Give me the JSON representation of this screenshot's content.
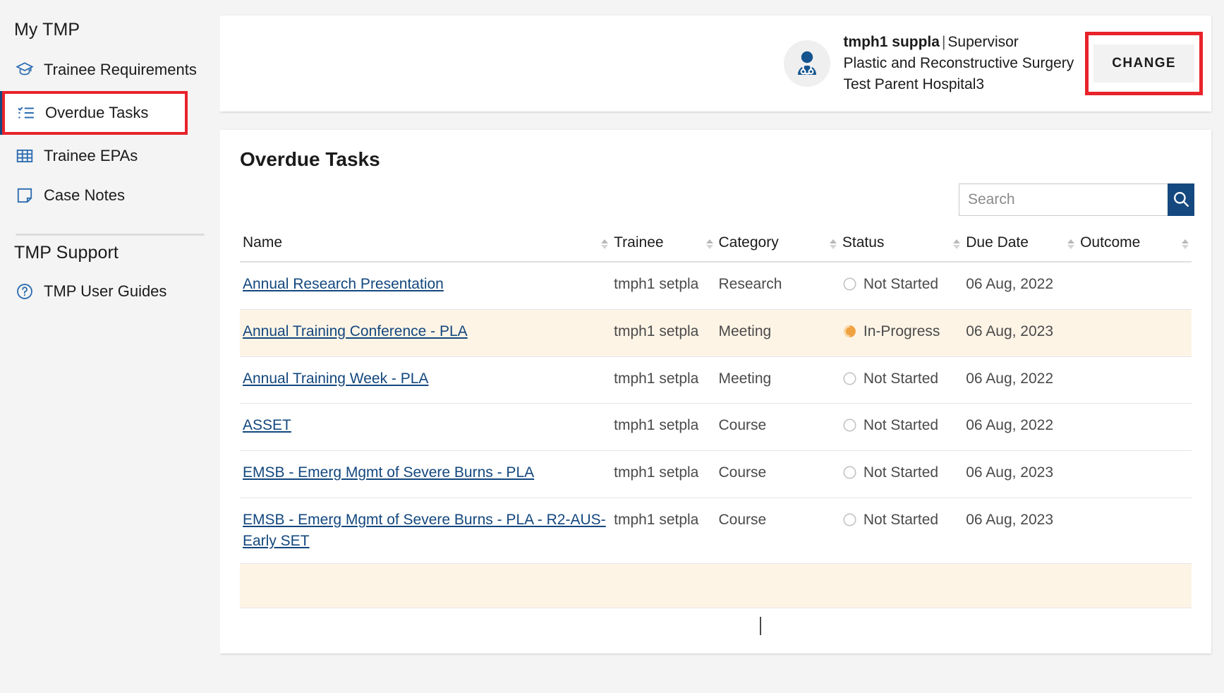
{
  "sidebar": {
    "sections": [
      {
        "heading": "My TMP",
        "items": [
          {
            "label": "Trainee Requirements",
            "icon": "graduation-cap-icon",
            "active": false
          },
          {
            "label": "Overdue Tasks",
            "icon": "checklist-icon",
            "active": true
          },
          {
            "label": "Trainee EPAs",
            "icon": "table-grid-icon",
            "active": false
          },
          {
            "label": "Case Notes",
            "icon": "note-page-icon",
            "active": false
          }
        ]
      },
      {
        "heading": "TMP Support",
        "items": [
          {
            "label": "TMP User Guides",
            "icon": "question-circle-icon",
            "active": false
          }
        ]
      }
    ]
  },
  "profile": {
    "avatar_icon": "doctor-avatar-icon",
    "name": "tmph1 suppla",
    "separator": "|",
    "role": "Supervisor",
    "specialty": "Plastic and Reconstructive Surgery",
    "hospital": "Test Parent Hospital3",
    "change_label": "CHANGE"
  },
  "tasks": {
    "title": "Overdue Tasks",
    "search": {
      "placeholder": "Search",
      "value": "",
      "button_icon": "search-icon"
    },
    "columns": [
      {
        "label": "Name",
        "sortable": true
      },
      {
        "label": "Trainee",
        "sortable": true
      },
      {
        "label": "Category",
        "sortable": true
      },
      {
        "label": "Status",
        "sortable": true
      },
      {
        "label": "Due Date",
        "sortable": true
      },
      {
        "label": "Outcome",
        "sortable": true
      }
    ],
    "rows": [
      {
        "name": "Annual Research Presentation",
        "trainee": "tmph1 setpla",
        "category": "Research",
        "status": "Not Started",
        "status_icon": "empty-circle-icon",
        "due_date": "06 Aug, 2022",
        "outcome": "",
        "highlight": false
      },
      {
        "name": "Annual Training Conference - PLA",
        "trainee": "tmph1 setpla",
        "category": "Meeting",
        "status": "In-Progress",
        "status_icon": "in-progress-icon",
        "due_date": "06 Aug, 2023",
        "outcome": "",
        "highlight": true
      },
      {
        "name": "Annual Training Week - PLA",
        "trainee": "tmph1 setpla",
        "category": "Meeting",
        "status": "Not Started",
        "status_icon": "empty-circle-icon",
        "due_date": "06 Aug, 2022",
        "outcome": "",
        "highlight": false
      },
      {
        "name": "ASSET",
        "trainee": "tmph1 setpla",
        "category": "Course",
        "status": "Not Started",
        "status_icon": "empty-circle-icon",
        "due_date": "06 Aug, 2022",
        "outcome": "",
        "highlight": false
      },
      {
        "name": "EMSB - Emerg Mgmt of Severe Burns - PLA",
        "trainee": "tmph1 setpla",
        "category": "Course",
        "status": "Not Started",
        "status_icon": "empty-circle-icon",
        "due_date": "06 Aug, 2023",
        "outcome": "",
        "highlight": false
      },
      {
        "name": "EMSB - Emerg Mgmt of Severe Burns - PLA - R2-AUS-Early SET",
        "trainee": "tmph1 setpla",
        "category": "Course",
        "status": "Not Started",
        "status_icon": "empty-circle-icon",
        "due_date": "06 Aug, 2023",
        "outcome": "",
        "highlight": false
      },
      {
        "name": "",
        "trainee": "",
        "category": "",
        "status": "",
        "status_icon": "",
        "due_date": "",
        "outcome": "",
        "highlight": true
      }
    ]
  },
  "colors": {
    "accent_blue": "#14487f",
    "link_blue": "#13477e",
    "annotation_red": "#e8232a",
    "highlight_row": "#fdf4e6",
    "in_progress_orange": "#f0a141",
    "page_bg": "#f4f4f4"
  }
}
